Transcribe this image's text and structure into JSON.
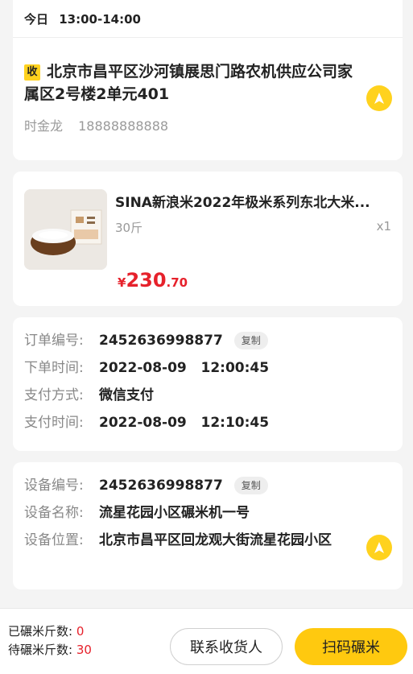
{
  "delivery": {
    "day": "今日",
    "time_range": "13:00-14:00"
  },
  "address": {
    "tag": "收",
    "text": "北京市昌平区沙河镇展思门路农机供应公司家属区2号楼2单元401",
    "contact_name": "时金龙",
    "contact_phone": "18888888888",
    "nav_icon": "navigation-arrow-icon"
  },
  "product": {
    "name": "SINA新浪米2022年极米系列东北大米...",
    "spec": "30斤",
    "qty": "x1",
    "price_symbol": "¥",
    "price_int": "230",
    "price_dec": ".70"
  },
  "order": {
    "id_label": "订单编号:",
    "id_value": "2452636998877",
    "copy_label": "复制",
    "created_label": "下单时间:",
    "created_value": "2022-08-09   12:00:45",
    "pay_method_label": "支付方式:",
    "pay_method_value": "微信支付",
    "paid_label": "支付时间:",
    "paid_value": "2022-08-09   12:10:45"
  },
  "device": {
    "id_label": "设备编号:",
    "id_value": "2452636998877",
    "copy_label": "复制",
    "name_label": "设备名称:",
    "name_value": "流星花园小区碾米机一号",
    "location_label": "设备位置:",
    "location_value": "北京市昌平区回龙观大街流星花园小区"
  },
  "footer": {
    "milled_label": "已碾米斤数:",
    "milled_value": "0",
    "pending_label": "待碾米斤数:",
    "pending_value": "30",
    "contact_button": "联系收货人",
    "scan_button": "扫码碾米"
  },
  "colors": {
    "accent_yellow": "#ffd21e",
    "price_red": "#e6212b"
  }
}
